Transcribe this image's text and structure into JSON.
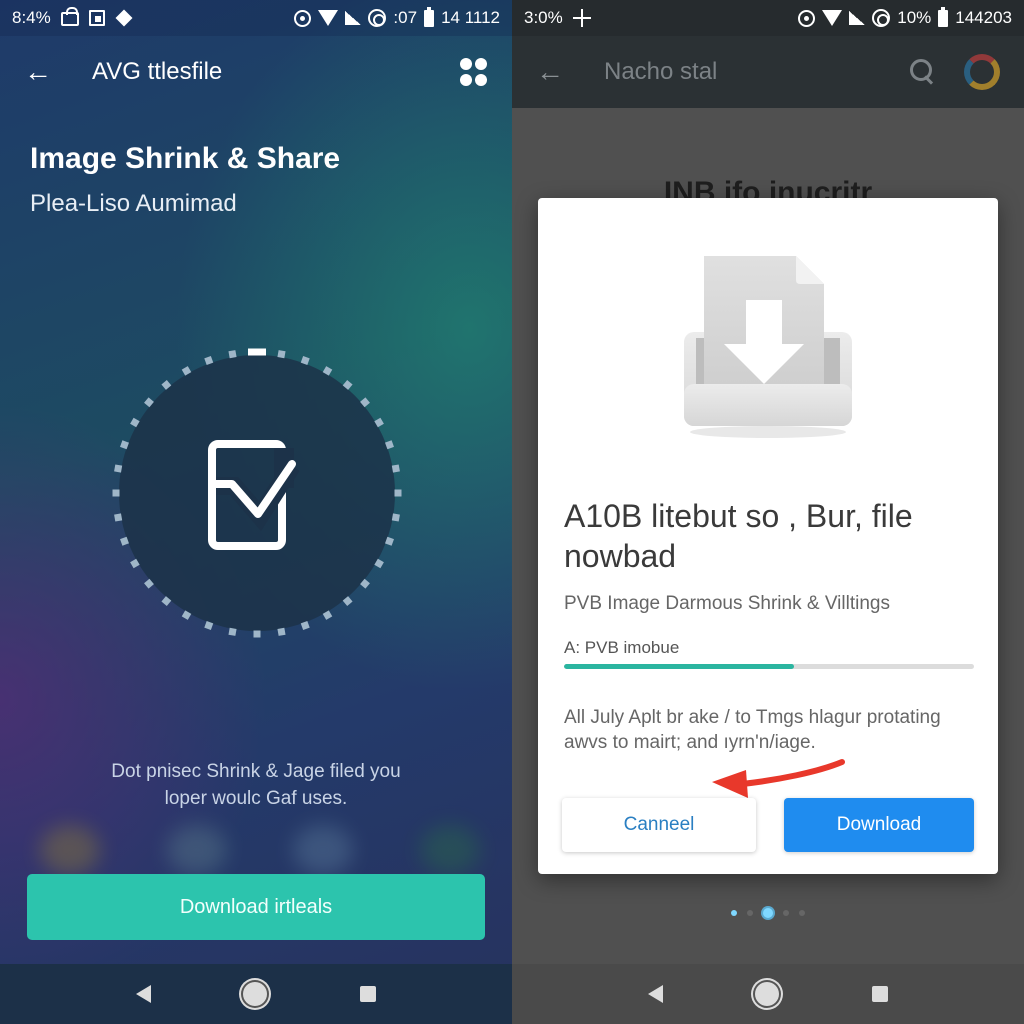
{
  "left_screen": {
    "status_bar": {
      "left_text": "8:4%",
      "right_text_1": ":07",
      "right_text_2": "14 1112",
      "icons": [
        "lock-icon",
        "photo-icon",
        "diamond-icon",
        "record-icon",
        "wifi-icon",
        "signal-icon",
        "ring-icon",
        "battery-icon"
      ]
    },
    "app_bar": {
      "title": "AVG ttlesfile",
      "back_icon": "arrow-left-icon",
      "menu_icon": "grid-dots-icon"
    },
    "hero": {
      "title": "Image Shrink & Share",
      "subtitle": "Plea-Liso Aumimad"
    },
    "progress_ring": {
      "center_icon": "document-check-icon",
      "active_segments": 1
    },
    "message": {
      "line1": "Dot pnisec Shrink & Jage filed you",
      "line2": "loper woulc Gaf uses."
    },
    "blurred_app_colors": [
      "#8a7a3a",
      "#5a7a8a",
      "#5a7a9a",
      "#2a6a4a"
    ],
    "primary_button": {
      "label": "Download irtleals",
      "color": "#2cc4ad"
    },
    "nav": {
      "back": "back-triangle-icon",
      "home": "home-circle-icon",
      "recents": "recents-square-icon"
    }
  },
  "right_screen": {
    "status_bar": {
      "left_text": "3:0%",
      "right_text_1": "10%",
      "right_text_2": "144203",
      "icons": [
        "plus-icon",
        "record-icon",
        "wifi-icon",
        "signal-icon",
        "ring-icon",
        "battery-icon"
      ]
    },
    "app_bar": {
      "title": "Nacho stal",
      "back_icon": "arrow-left-icon",
      "search_icon": "search-icon",
      "logo_icon": "app-logo-icon"
    },
    "background_heading": "INB ifo inucritr",
    "dialog": {
      "illustration": "download-tray-icon",
      "title": "A10B litebut so , Bur, file nowbad",
      "subtitle": "PVB Image Darmous Shrink & Villtings",
      "progress_label": "A: PVB imobue",
      "progress_percent": 56,
      "body": "All July Aplt br ake / to Tmgs hlagur protating awvs to mairt; and ıyrn'n/iage.",
      "cancel_label": "Canneel",
      "download_label": "Download",
      "accent_color": "#1f8cef",
      "progress_color": "#2bb5a0",
      "annotation_arrow_color": "#e8382b"
    },
    "page_indicator": {
      "count": 5,
      "active_index": 2,
      "highlighted_index": 0
    },
    "nav": {
      "back": "back-triangle-icon",
      "home": "home-circle-icon",
      "recents": "recents-square-icon"
    }
  }
}
